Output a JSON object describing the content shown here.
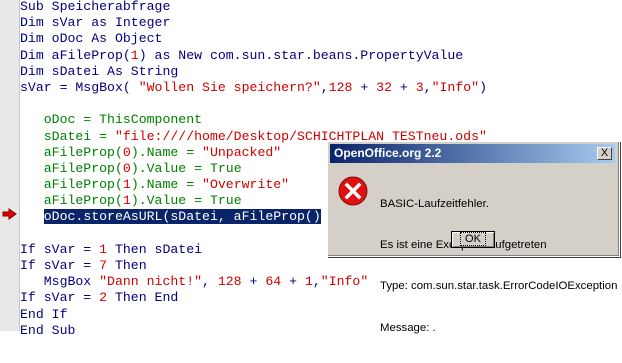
{
  "editor": {
    "lines": [
      [
        {
          "t": "Sub Speicherabfrage",
          "c": "kw"
        }
      ],
      [
        {
          "t": "Dim sVar as Integer",
          "c": "kw"
        }
      ],
      [
        {
          "t": "Dim oDoc As Object",
          "c": "kw"
        }
      ],
      [
        {
          "t": "Dim aFileProp(",
          "c": "kw"
        },
        {
          "t": "1",
          "c": "red"
        },
        {
          "t": ") as New com.sun.star.beans.PropertyValue",
          "c": "kw"
        }
      ],
      [
        {
          "t": "Dim sDatei As String",
          "c": "kw"
        }
      ],
      [
        {
          "t": "sVar = MsgBox( ",
          "c": "kw"
        },
        {
          "t": "\"Wollen Sie speichern?\"",
          "c": "red"
        },
        {
          "t": ",",
          "c": "kw"
        },
        {
          "t": "128",
          "c": "red"
        },
        {
          "t": " + ",
          "c": "kw"
        },
        {
          "t": "32",
          "c": "red"
        },
        {
          "t": " + ",
          "c": "kw"
        },
        {
          "t": "3",
          "c": "red"
        },
        {
          "t": ",",
          "c": "kw"
        },
        {
          "t": "\"Info\"",
          "c": "red"
        },
        {
          "t": ")",
          "c": "kw"
        }
      ],
      [
        {
          "t": "",
          "c": "kw"
        }
      ],
      [
        {
          "t": "   oDoc = ThisComponent",
          "c": "green"
        }
      ],
      [
        {
          "t": "   sDatei = ",
          "c": "green"
        },
        {
          "t": "\"file:////home/Desktop/SCHICHTPLAN TESTneu.ods\"",
          "c": "red"
        }
      ],
      [
        {
          "t": "   aFileProp(",
          "c": "green"
        },
        {
          "t": "0",
          "c": "red"
        },
        {
          "t": ").Name = ",
          "c": "green"
        },
        {
          "t": "\"Unpacked\"",
          "c": "red"
        }
      ],
      [
        {
          "t": "   aFileProp(",
          "c": "green"
        },
        {
          "t": "0",
          "c": "red"
        },
        {
          "t": ").Value = True",
          "c": "green"
        }
      ],
      [
        {
          "t": "   aFileProp(",
          "c": "green"
        },
        {
          "t": "1",
          "c": "red"
        },
        {
          "t": ").Name = ",
          "c": "green"
        },
        {
          "t": "\"Overwrite\"",
          "c": "red"
        }
      ],
      [
        {
          "t": "   aFileProp(",
          "c": "green"
        },
        {
          "t": "1",
          "c": "red"
        },
        {
          "t": ").Value = True",
          "c": "green"
        }
      ],
      [
        {
          "t": "   ",
          "c": "green"
        },
        {
          "t": "oDoc.storeAsURL(sDatei, aFileProp()",
          "c": "sel"
        }
      ],
      [
        {
          "t": "",
          "c": "kw"
        }
      ],
      [
        {
          "t": "If sVar = ",
          "c": "kw"
        },
        {
          "t": "1",
          "c": "red"
        },
        {
          "t": " Then sDatei",
          "c": "kw"
        }
      ],
      [
        {
          "t": "If sVar = ",
          "c": "kw"
        },
        {
          "t": "7",
          "c": "red"
        },
        {
          "t": " Then",
          "c": "kw"
        }
      ],
      [
        {
          "t": "   MsgBox ",
          "c": "kw"
        },
        {
          "t": "\"Dann nicht!\"",
          "c": "red"
        },
        {
          "t": ", ",
          "c": "kw"
        },
        {
          "t": "128",
          "c": "red"
        },
        {
          "t": " + ",
          "c": "kw"
        },
        {
          "t": "64",
          "c": "red"
        },
        {
          "t": " + ",
          "c": "kw"
        },
        {
          "t": "1",
          "c": "red"
        },
        {
          "t": ",",
          "c": "kw"
        },
        {
          "t": "\"Info\"",
          "c": "red"
        }
      ],
      [
        {
          "t": "If sVar = ",
          "c": "kw"
        },
        {
          "t": "2",
          "c": "red"
        },
        {
          "t": " Then End",
          "c": "kw"
        }
      ],
      [
        {
          "t": "End If",
          "c": "kw"
        }
      ],
      [
        {
          "t": "End Sub",
          "c": "kw"
        }
      ]
    ],
    "current_line_icon": "execution-arrow-icon"
  },
  "dialog": {
    "title": "OpenOffice.org 2.2",
    "close_label": "X",
    "icon": "error-icon",
    "message_lines": [
      "BASIC-Laufzeitfehler.",
      "Es ist eine Exception aufgetreten",
      "Type: com.sun.star.task.ErrorCodeIOException",
      "Message: ."
    ],
    "ok_label": "OK"
  },
  "colors": {
    "keyword": "#000080",
    "comment_block": "#008000",
    "literal": "#d00000",
    "selection": "#0a246a",
    "titlebar_start": "#0a246a",
    "titlebar_end": "#a6caf0",
    "dialog_face": "#d4d0c8"
  }
}
